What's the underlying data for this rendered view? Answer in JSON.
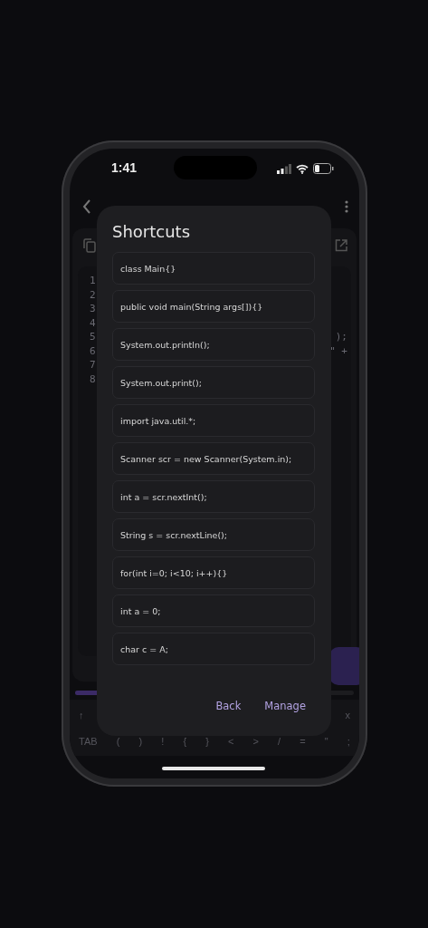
{
  "status_bar": {
    "time": "1:41"
  },
  "editor": {
    "lines": [
      {
        "number": "1"
      },
      {
        "number": "2"
      },
      {
        "number": "3"
      },
      {
        "number": "4"
      },
      {
        "number": "5",
        "code": ");"
      },
      {
        "number": "6",
        "code": "\" +"
      },
      {
        "number": "7"
      },
      {
        "number": "8"
      }
    ]
  },
  "progress": {
    "level": 0.09
  },
  "keyboard": {
    "up_key": "↑",
    "close_key": "x",
    "keys": [
      "TAB",
      "(",
      ")",
      "!",
      "{",
      "}",
      "<",
      ">",
      "/",
      "=",
      "\"",
      ";"
    ]
  },
  "dialog": {
    "title": "Shortcuts",
    "shortcuts": [
      "class Main{}",
      "public void main(String args[]){}",
      "System.out.println();",
      "System.out.print();",
      "import java.util.*;",
      "Scanner scr = new Scanner(System.in);",
      "int a = scr.nextInt();",
      "String s = scr.nextLine();",
      "for(int i=0; i<10; i++){}",
      "int a = 0;",
      "char c = A;"
    ],
    "buttons": [
      "Back",
      "Manage"
    ]
  }
}
